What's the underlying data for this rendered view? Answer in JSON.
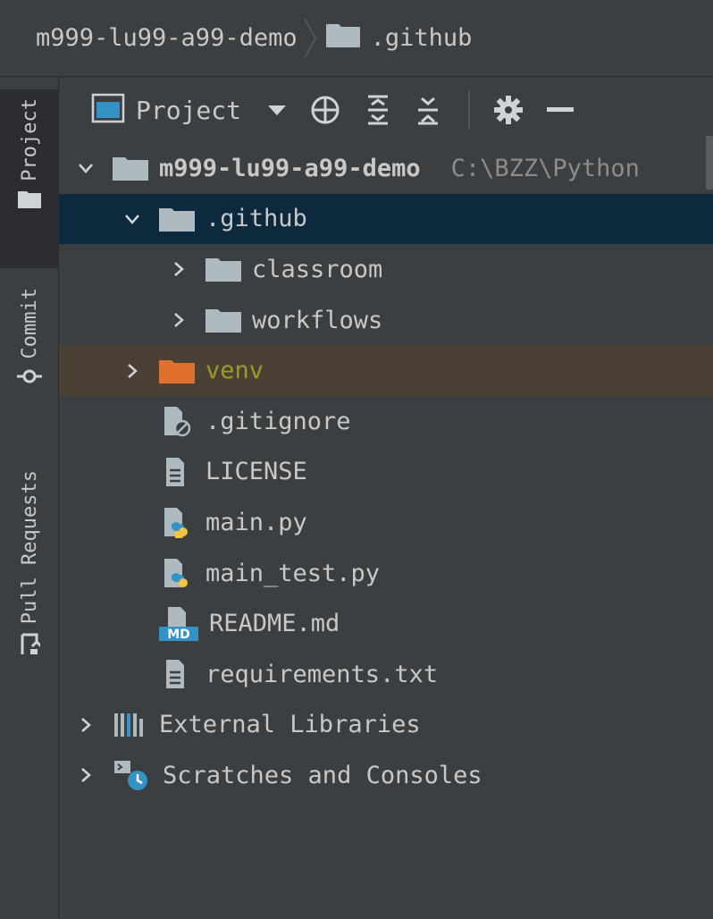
{
  "navbar": {
    "project_crumb": "m999-lu99-a99-demo",
    "folder_crumb": ".github"
  },
  "tool_strip": {
    "project_tab": "Project",
    "commit_tab": "Commit",
    "pull_requests_tab": "Pull Requests"
  },
  "toolbar": {
    "title": "Project"
  },
  "tree": {
    "root": {
      "name": "m999-lu99-a99-demo",
      "path": "C:\\BZZ\\Python"
    },
    "github": ".github",
    "classroom": "classroom",
    "workflows": "workflows",
    "venv": "venv",
    "gitignore": ".gitignore",
    "license": "LICENSE",
    "main_py": "main.py",
    "main_test_py": "main_test.py",
    "readme": "README.md",
    "requirements": "requirements.txt",
    "external_libraries": "External Libraries",
    "scratches": "Scratches and Consoles"
  },
  "icons": {
    "md_badge": "MD"
  },
  "colors": {
    "panel_bg": "#3c3f41",
    "selected_row": "#0d293e",
    "excluded_row": "#4a4134",
    "venv_folder": "#e0702e",
    "venv_text": "#9a9a2a",
    "folder": "#aeb9c0",
    "accent_blue": "#3592c4"
  }
}
